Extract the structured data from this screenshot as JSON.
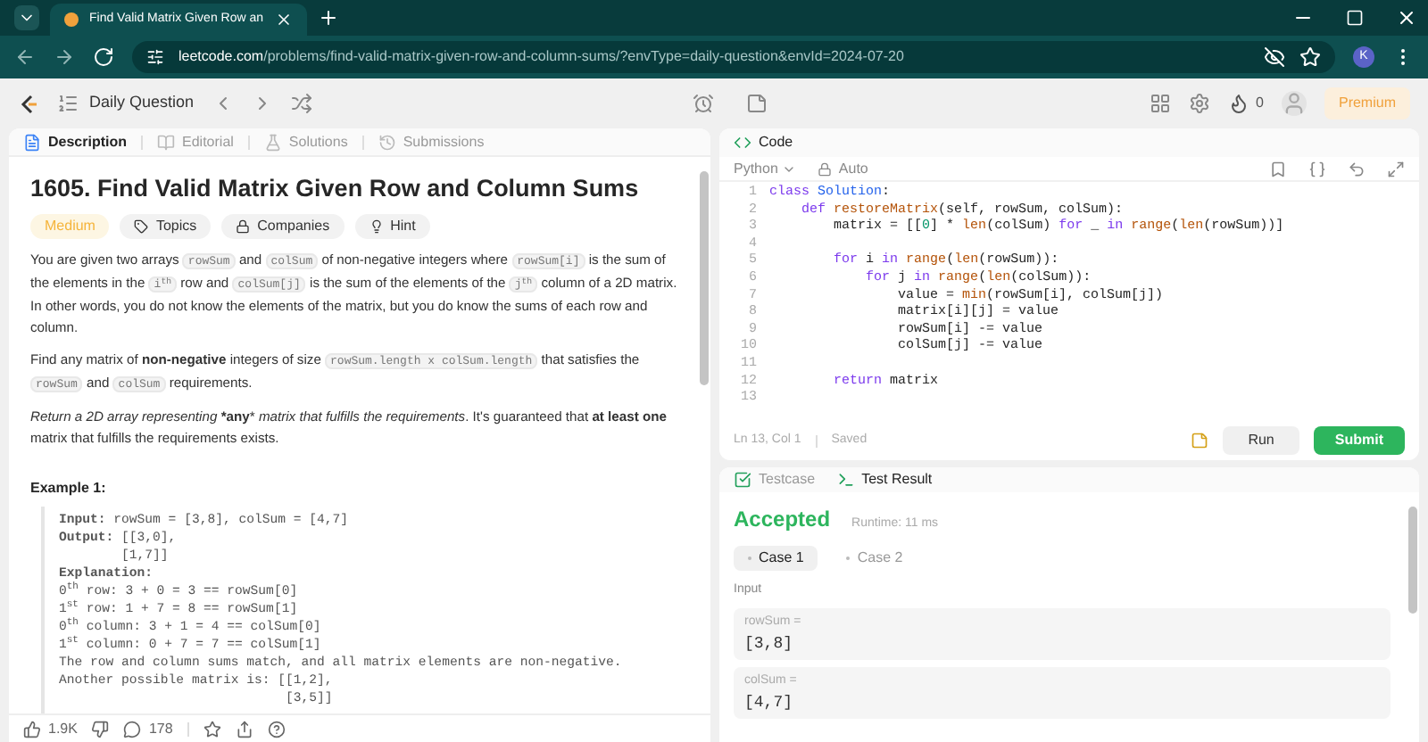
{
  "browser": {
    "tab_title": "Find Valid Matrix Given Row an",
    "url_host": "leetcode.com",
    "url_path": "/problems/find-valid-matrix-given-row-and-column-sums/?envType=daily-question&envId=2024-07-20",
    "profile_initial": "K"
  },
  "header": {
    "daily_label": "Daily Question",
    "streak_count": "0",
    "premium_label": "Premium"
  },
  "left_tabs": [
    {
      "label": "Description",
      "selected": true
    },
    {
      "label": "Editorial",
      "selected": false
    },
    {
      "label": "Solutions",
      "selected": false
    },
    {
      "label": "Submissions",
      "selected": false
    }
  ],
  "problem": {
    "title": "1605. Find Valid Matrix Given Row and Column Sums",
    "tags": [
      {
        "kind": "difficulty",
        "label": "Medium"
      },
      {
        "kind": "topics",
        "label": "Topics"
      },
      {
        "kind": "companies",
        "label": "Companies"
      },
      {
        "kind": "hint",
        "label": "Hint"
      }
    ],
    "paragraphs": [
      {
        "segments": [
          {
            "kind": "text",
            "text": "You are given two arrays "
          },
          {
            "kind": "code",
            "text": "rowSum"
          },
          {
            "kind": "text",
            "text": " and "
          },
          {
            "kind": "code",
            "text": "colSum"
          },
          {
            "kind": "text",
            "text": " of non-negative integers where "
          },
          {
            "kind": "code",
            "text": "rowSum[i]"
          },
          {
            "kind": "text",
            "text": " is the sum of the elements in the "
          },
          {
            "kind": "code",
            "text": "i$^{th}$"
          },
          {
            "kind": "text",
            "text": " row and "
          },
          {
            "kind": "code",
            "text": "colSum[j]"
          },
          {
            "kind": "text",
            "text": " is the sum of the elements of the "
          },
          {
            "kind": "code",
            "text": "j$^{th}$"
          },
          {
            "kind": "text",
            "text": " column of a 2D matrix. In other words, you do not know the elements of the matrix, but you do know the sums of each row and column."
          }
        ]
      },
      {
        "segments": [
          {
            "kind": "text",
            "text": "Find any matrix of **non-negative** integers of size "
          },
          {
            "kind": "code",
            "text": "rowSum.length x colSum.length"
          },
          {
            "kind": "text",
            "text": " that satisfies the "
          },
          {
            "kind": "code",
            "text": "rowSum"
          },
          {
            "kind": "text",
            "text": " and "
          },
          {
            "kind": "code",
            "text": "colSum"
          },
          {
            "kind": "text",
            "text": " requirements."
          }
        ]
      },
      {
        "segments": [
          {
            "kind": "text",
            "text": "*Return a 2D array representing* ***any*** *matrix that fulfills the requirements*. It's guaranteed that **at least one** matrix that fulfills the requirements exists."
          }
        ]
      }
    ],
    "example_title": "Example 1:",
    "example_lines": [
      "**Input:** rowSum = [3,8], colSum = [4,7]",
      "**Output:** [[3,0],",
      "        [1,7]]",
      "**Explanation:**",
      "0$^{th}$ row: 3 + 0 = 3 == rowSum[0]",
      "1$^{st}$ row: 1 + 7 = 8 == rowSum[1]",
      "0$^{th}$ column: 3 + 1 = 4 == colSum[0]",
      "1$^{st}$ column: 0 + 7 = 7 == colSum[1]",
      "The row and column sums match, and all matrix elements are non-negative.",
      "Another possible matrix is: [[1,2],",
      "                             [3,5]]"
    ]
  },
  "footer": {
    "likes": "1.9K",
    "comments": "178"
  },
  "code_panel": {
    "title": "Code",
    "language": "Python",
    "mode": "Auto",
    "lines": [
      {
        "number": "1",
        "tokens": [
          {
            "kind": "kw",
            "text": "class "
          },
          {
            "kind": "cls",
            "text": "Solution"
          },
          {
            "kind": "p",
            "text": ":"
          }
        ]
      },
      {
        "number": "2",
        "tokens": [
          {
            "kind": "kw",
            "text": "    def "
          },
          {
            "kind": "fn",
            "text": "restoreMatrix"
          },
          {
            "kind": "p",
            "text": "(self, rowSum, colSum):"
          }
        ]
      },
      {
        "number": "3",
        "tokens": [
          {
            "kind": "p",
            "text": "        matrix = [["
          },
          {
            "kind": "num",
            "text": "0"
          },
          {
            "kind": "p",
            "text": "] * "
          },
          {
            "kind": "fn",
            "text": "len"
          },
          {
            "kind": "p",
            "text": "(colSum) "
          },
          {
            "kind": "kw",
            "text": "for"
          },
          {
            "kind": "p",
            "text": " _ "
          },
          {
            "kind": "kw",
            "text": "in "
          },
          {
            "kind": "fn",
            "text": "range"
          },
          {
            "kind": "p",
            "text": "("
          },
          {
            "kind": "fn",
            "text": "len"
          },
          {
            "kind": "p",
            "text": "(rowSum))]"
          }
        ]
      },
      {
        "number": "4"
      },
      {
        "number": "5",
        "tokens": [
          {
            "kind": "kw",
            "text": "        for"
          },
          {
            "kind": "p",
            "text": " i "
          },
          {
            "kind": "kw",
            "text": "in "
          },
          {
            "kind": "fn",
            "text": "range"
          },
          {
            "kind": "p",
            "text": "("
          },
          {
            "kind": "fn",
            "text": "len"
          },
          {
            "kind": "p",
            "text": "(rowSum)):"
          }
        ]
      },
      {
        "number": "6",
        "tokens": [
          {
            "kind": "kw",
            "text": "            for"
          },
          {
            "kind": "p",
            "text": " j "
          },
          {
            "kind": "kw",
            "text": "in "
          },
          {
            "kind": "fn",
            "text": "range"
          },
          {
            "kind": "p",
            "text": "("
          },
          {
            "kind": "fn",
            "text": "len"
          },
          {
            "kind": "p",
            "text": "(colSum)):"
          }
        ]
      },
      {
        "number": "7",
        "tokens": [
          {
            "kind": "p",
            "text": "                value = "
          },
          {
            "kind": "fn",
            "text": "min"
          },
          {
            "kind": "p",
            "text": "(rowSum[i], colSum[j])"
          }
        ]
      },
      {
        "number": "8",
        "tokens": [
          {
            "kind": "p",
            "text": "                matrix[i][j] = value"
          }
        ]
      },
      {
        "number": "9",
        "tokens": [
          {
            "kind": "p",
            "text": "                rowSum[i] -= value"
          }
        ]
      },
      {
        "number": "10",
        "tokens": [
          {
            "kind": "p",
            "text": "                colSum[j] -= value"
          }
        ]
      },
      {
        "number": "11"
      },
      {
        "number": "12",
        "tokens": [
          {
            "kind": "kw",
            "text": "        return"
          },
          {
            "kind": "p",
            "text": " matrix"
          }
        ]
      },
      {
        "number": "13"
      }
    ],
    "status": "Ln 13, Col 1",
    "saved": "Saved",
    "run_label": "Run",
    "submit_label": "Submit"
  },
  "result_panel": {
    "tabs": [
      {
        "label": "Testcase",
        "selected": false
      },
      {
        "label": "Test Result",
        "selected": true
      }
    ],
    "verdict": "Accepted",
    "runtime": "Runtime: 11 ms",
    "cases": [
      {
        "label": "Case 1",
        "selected": true
      },
      {
        "label": "Case 2",
        "selected": false
      }
    ],
    "input_label": "Input",
    "inputs": [
      {
        "name": "rowSum =",
        "value": "[3,8]"
      },
      {
        "name": "colSum =",
        "value": "[4,7]"
      }
    ]
  }
}
